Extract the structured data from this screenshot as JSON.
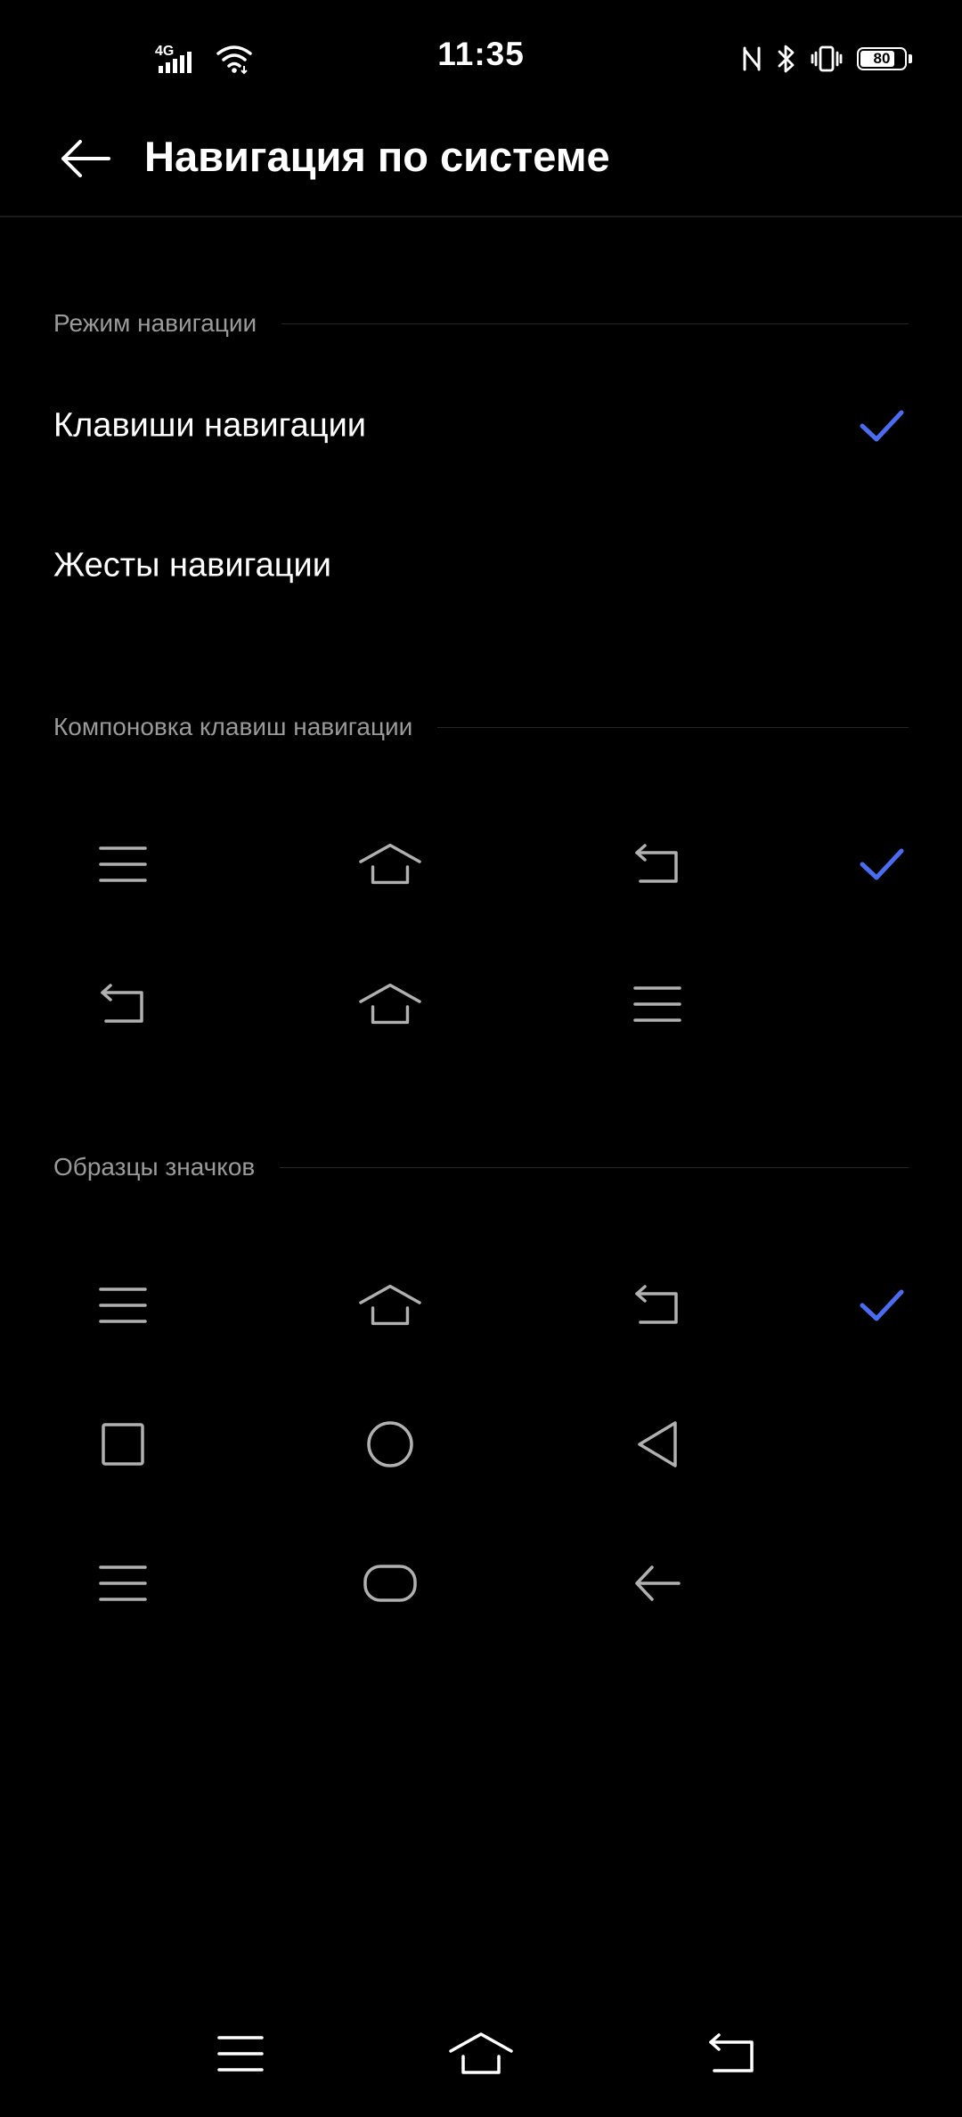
{
  "status_bar": {
    "time": "11:35",
    "network": "4G",
    "battery": "80",
    "battery_level": 0.8
  },
  "header": {
    "title": "Навигация по системе",
    "back_icon": "arrow-left-icon"
  },
  "sections": {
    "mode": {
      "label": "Режим навигации",
      "options": [
        {
          "label": "Клавиши навигации",
          "selected": true
        },
        {
          "label": "Жесты навигации",
          "selected": false
        }
      ]
    },
    "layout": {
      "label": "Компоновка клавиш навигации",
      "rows": [
        {
          "icons": [
            "menu-icon",
            "home-icon",
            "back-return-icon"
          ],
          "selected": true
        },
        {
          "icons": [
            "back-return-icon",
            "home-icon",
            "menu-icon"
          ],
          "selected": false
        }
      ]
    },
    "icon_style": {
      "label": "Образцы значков",
      "rows": [
        {
          "icons": [
            "menu-icon",
            "home-icon",
            "back-return-icon"
          ],
          "selected": true
        },
        {
          "icons": [
            "square-icon",
            "circle-icon",
            "triangle-back-icon"
          ],
          "selected": false
        },
        {
          "icons": [
            "menu-icon",
            "rounded-rect-icon",
            "arrow-back-icon"
          ],
          "selected": false
        }
      ]
    }
  },
  "colors": {
    "background": "#000000",
    "accent": "#4a6cf0",
    "text_primary": "#ffffff",
    "text_secondary": "#9a9a9a",
    "icon": "#b0b0b0"
  },
  "nav_bar": {
    "icons": [
      "menu-icon",
      "home-icon",
      "back-return-icon"
    ]
  }
}
